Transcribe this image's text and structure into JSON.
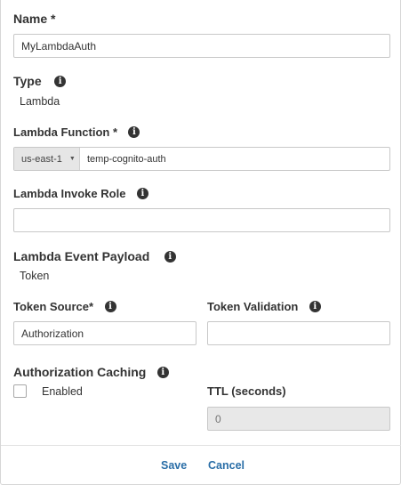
{
  "name": {
    "label": "Name *",
    "value": "MyLambdaAuth"
  },
  "type": {
    "label": "Type",
    "value": "Lambda"
  },
  "lambda_function": {
    "label": "Lambda Function *",
    "region": "us-east-1",
    "value": "temp-cognito-auth"
  },
  "invoke_role": {
    "label": "Lambda Invoke Role",
    "value": ""
  },
  "event_payload": {
    "label": "Lambda Event Payload",
    "value": "Token"
  },
  "token_source": {
    "label": "Token Source*",
    "value": "Authorization"
  },
  "token_validation": {
    "label": "Token Validation",
    "value": ""
  },
  "caching": {
    "label": "Authorization Caching",
    "enabled_label": "Enabled",
    "enabled": false
  },
  "ttl": {
    "label": "TTL (seconds)",
    "placeholder": "0"
  },
  "footer": {
    "save_label": "Save",
    "cancel_label": "Cancel"
  },
  "icons": {
    "info": "info-icon",
    "caret": "caret-down-icon"
  }
}
